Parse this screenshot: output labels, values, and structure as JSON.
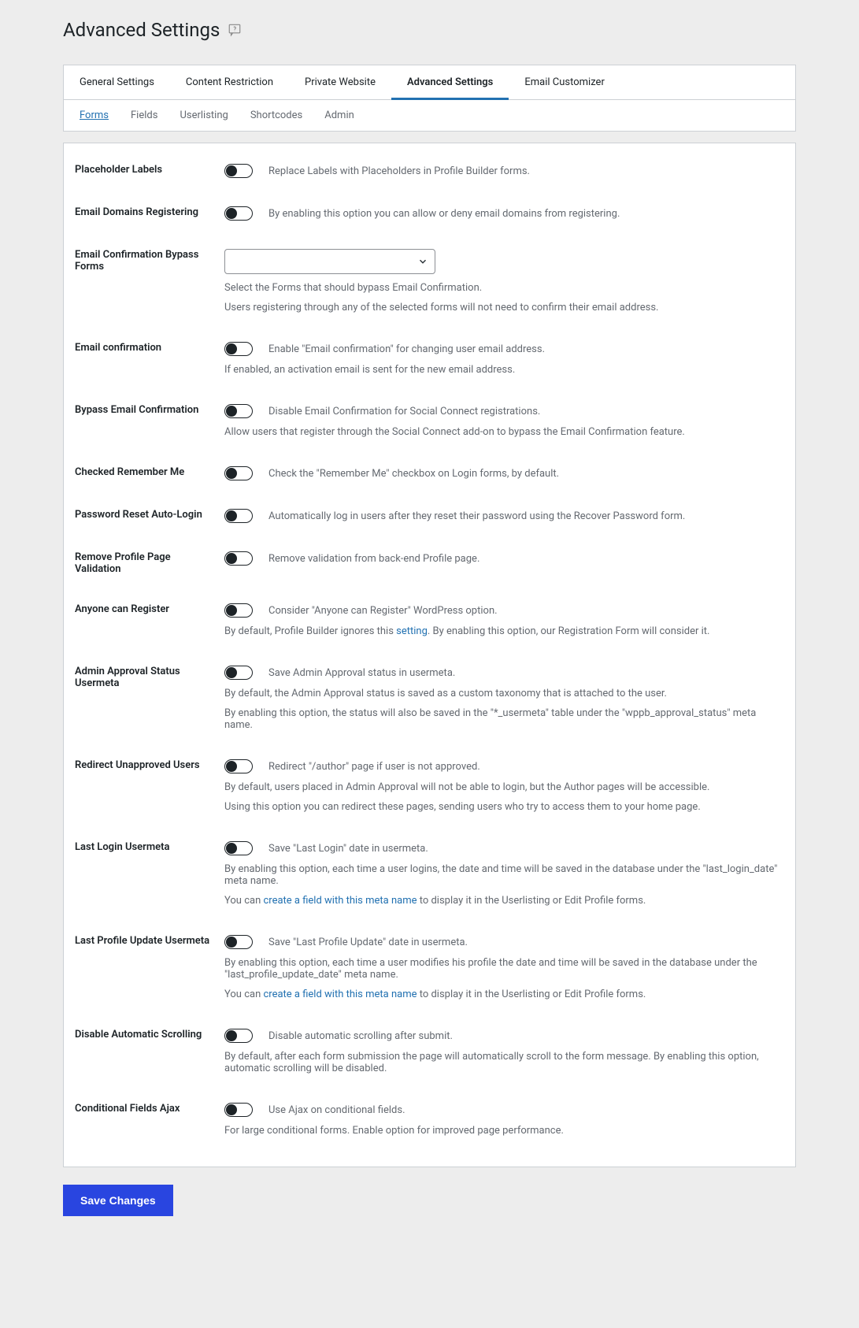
{
  "page_title": "Advanced Settings",
  "main_tabs": {
    "t0": "General Settings",
    "t1": "Content Restriction",
    "t2": "Private Website",
    "t3": "Advanced Settings",
    "t4": "Email Customizer"
  },
  "sub_tabs": {
    "s0": "Forms",
    "s1": "Fields",
    "s2": "Userlisting",
    "s3": "Shortcodes",
    "s4": "Admin"
  },
  "rows": {
    "placeholder_labels": {
      "label": "Placeholder Labels",
      "desc": "Replace Labels with Placeholders in Profile Builder forms."
    },
    "email_domains_registering": {
      "label": "Email Domains Registering",
      "desc": "By enabling this option you can allow or deny email domains from registering."
    },
    "email_conf_bypass": {
      "label": "Email Confirmation Bypass Forms",
      "select_value": "",
      "desc1": "Select the Forms that should bypass Email Confirmation.",
      "desc2": "Users registering through any of the selected forms will not need to confirm their email address."
    },
    "email_confirmation": {
      "label": "Email confirmation",
      "desc": "Enable \"Email confirmation\" for changing user email address.",
      "desc2": "If enabled, an activation email is sent for the new email address."
    },
    "bypass_email_confirmation": {
      "label": "Bypass Email Confirmation",
      "desc": "Disable Email Confirmation for Social Connect registrations.",
      "desc2": "Allow users that register through the Social Connect add-on to bypass the Email Confirmation feature."
    },
    "checked_remember_me": {
      "label": "Checked Remember Me",
      "desc": "Check the \"Remember Me\" checkbox on Login forms, by default."
    },
    "password_reset_auto_login": {
      "label": "Password Reset Auto-Login",
      "desc": "Automatically log in users after they reset their password using the Recover Password form."
    },
    "remove_profile_page_validation": {
      "label": "Remove Profile Page Validation",
      "desc": "Remove validation from back-end Profile page."
    },
    "anyone_can_register": {
      "label": "Anyone can Register",
      "desc": "Consider \"Anyone can Register\" WordPress option.",
      "desc2_pre": "By default, Profile Builder ignores this ",
      "desc2_link": "setting",
      "desc2_post": ". By enabling this option, our Registration Form will consider it."
    },
    "admin_approval_status_usermeta": {
      "label": "Admin Approval Status Usermeta",
      "desc": "Save Admin Approval status in usermeta.",
      "desc2": "By default, the Admin Approval status is saved as a custom taxonomy that is attached to the user.",
      "desc3": "By enabling this option, the status will also be saved in the \"*_usermeta\" table under the \"wppb_approval_status\" meta name."
    },
    "redirect_unapproved_users": {
      "label": "Redirect Unapproved Users",
      "desc": "Redirect \"/author\" page if user is not approved.",
      "desc2": "By default, users placed in Admin Approval will not be able to login, but the Author pages will be accessible.",
      "desc3": "Using this option you can redirect these pages, sending users who try to access them to your home page."
    },
    "last_login_usermeta": {
      "label": "Last Login Usermeta",
      "desc": "Save \"Last Login\" date in usermeta.",
      "desc2": "By enabling this option, each time a user logins, the date and time will be saved in the database under the \"last_login_date\" meta name.",
      "desc3_pre": "You can ",
      "desc3_link": "create a field with this meta name",
      "desc3_post": " to display it in the Userlisting or Edit Profile forms."
    },
    "last_profile_update_usermeta": {
      "label": "Last Profile Update Usermeta",
      "desc": "Save \"Last Profile Update\" date in usermeta.",
      "desc2": "By enabling this option, each time a user modifies his profile the date and time will be saved in the database under the \"last_profile_update_date\" meta name.",
      "desc3_pre": "You can ",
      "desc3_link": "create a field with this meta name",
      "desc3_post": " to display it in the Userlisting or Edit Profile forms."
    },
    "disable_automatic_scrolling": {
      "label": "Disable Automatic Scrolling",
      "desc": "Disable automatic scrolling after submit.",
      "desc2": "By default, after each form submission the page will automatically scroll to the form message. By enabling this option, automatic scrolling will be disabled."
    },
    "conditional_fields_ajax": {
      "label": "Conditional Fields Ajax",
      "desc": "Use Ajax on conditional fields.",
      "desc2": "For large conditional forms. Enable option for improved page performance."
    }
  },
  "save_button": "Save Changes"
}
